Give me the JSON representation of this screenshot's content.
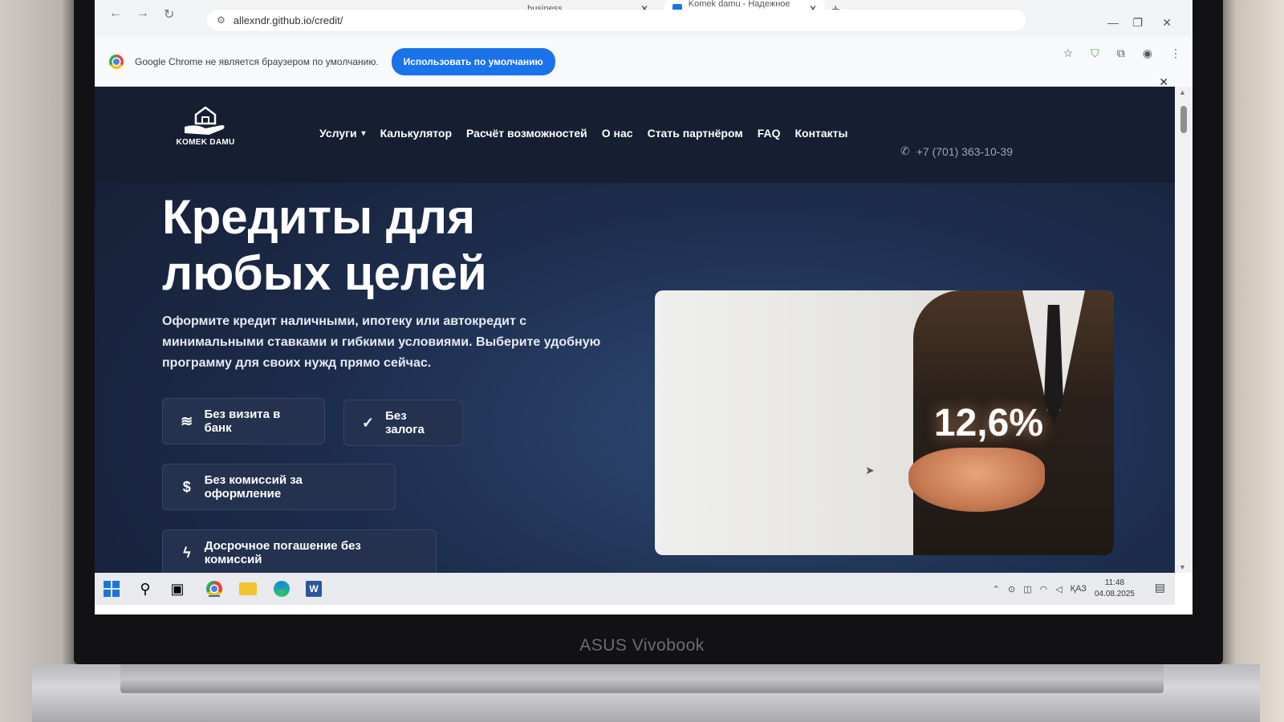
{
  "browser": {
    "tabs": [
      {
        "title": "...business"
      },
      {
        "title": "Komek damu - Надежное кред"
      }
    ],
    "new_tab": "+",
    "url": "allexndr.github.io/credit/",
    "infobar": {
      "message": "Google Chrome не является браузером по умолчанию.",
      "button": "Использовать по умолчанию"
    }
  },
  "site": {
    "logo_text": "KOMEK DAMU",
    "menu": [
      "Услуги",
      "Калькулятор",
      "Расчёт возможностей",
      "О нас",
      "Стать партнёром",
      "FAQ",
      "Контакты"
    ],
    "phone": "+7 (701) 363-10-39",
    "hero_title": "Кредиты для любых целей",
    "hero_desc": "Оформите кредит наличными, ипотеку или автокредит с минимальными ставками и гибкими условиями. Выберите удобную программу для своих нужд прямо сейчас.",
    "features": [
      {
        "label": "Без визита в банк",
        "icon": "layers-icon"
      },
      {
        "label": "Без залога",
        "icon": "check-circle-icon"
      },
      {
        "label": "Без комиссий за оформление",
        "icon": "dollar-icon"
      },
      {
        "label": "Досрочное погашение без комиссий",
        "icon": "lightning-icon"
      }
    ],
    "promo_rate": "12,6%"
  },
  "taskbar": {
    "language": "ҚАЗ",
    "time": "11:48",
    "date": "04.08.2025"
  },
  "device": {
    "brand": "ASUS Vivobook"
  },
  "colors": {
    "site_bg": "#1a2540",
    "accent_blue": "#1a73e8",
    "feature_bg": "#24324f"
  }
}
